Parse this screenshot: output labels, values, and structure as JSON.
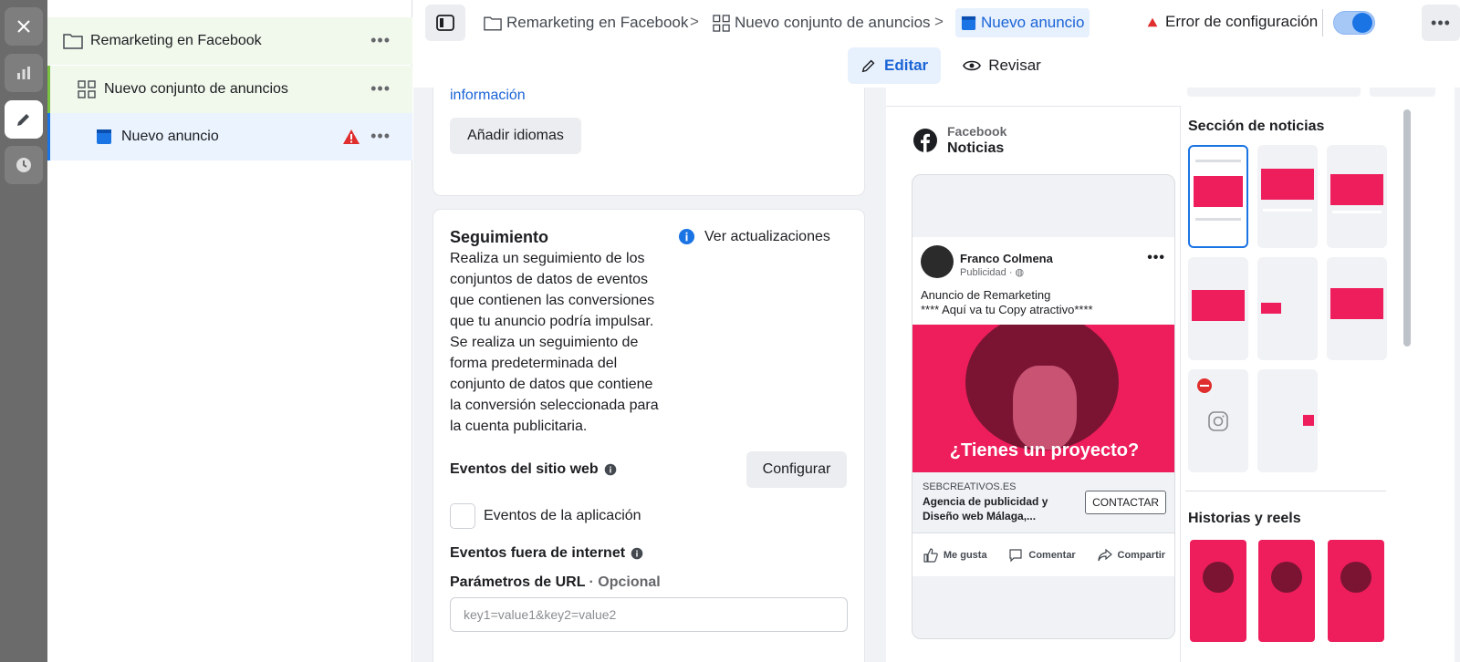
{
  "tree": {
    "campaign": "Remarketing en Facebook",
    "adset": "Nuevo conjunto de anuncios",
    "ad": "Nuevo anuncio"
  },
  "breadcrumb": {
    "campaign": "Remarketing en Facebook",
    "adset": "Nuevo conjunto de anuncios",
    "ad": "Nuevo anuncio",
    "sep": ">"
  },
  "status": {
    "error_label": "Error de configuración"
  },
  "modes": {
    "edit": "Editar",
    "review": "Revisar"
  },
  "form": {
    "info_link": "información",
    "add_languages": "Añadir idiomas",
    "tracking": {
      "title": "Seguimiento",
      "description": "Realiza un seguimiento de los conjuntos de datos de eventos que contienen las conversiones que tu anuncio podría impulsar. Se realiza un seguimiento de forma predeterminada del conjunto de datos que contiene la conversión seleccionada para la cuenta publicitaria.",
      "updates_link": "Ver actualizaciones",
      "website_events": "Eventos del sitio web",
      "configure": "Configurar",
      "app_events": "Eventos de la aplicación",
      "offline_events": "Eventos fuera de internet",
      "url_params_label": "Parámetros de URL",
      "url_params_optional": "· Opcional",
      "url_params_placeholder": "key1=value1&key2=value2"
    }
  },
  "preview": {
    "platform": "Facebook",
    "placement": "Noticias",
    "post": {
      "author": "Franco Colmena",
      "sponsored": "Publicidad · ",
      "text_line1": "Anuncio de Remarketing",
      "text_line2": "**** Aquí va tu Copy atractivo****",
      "headline_overlay": "¿Tienes un proyecto?",
      "domain": "SEBCREATIVOS.ES",
      "link_title": "Agencia de publicidad y Diseño web Málaga,...",
      "cta": "CONTACTAR",
      "like": "Me gusta",
      "comment": "Comentar",
      "share": "Compartir"
    },
    "sections": {
      "feed": "Sección de noticias",
      "stories": "Historias y reels"
    }
  },
  "colors": {
    "accent": "#1b74e4",
    "ad_pink": "#ee1d5c",
    "error": "#e02e2e",
    "tree_highlight": "#f1f8ec",
    "tree_selected": "#eaf3fe"
  }
}
